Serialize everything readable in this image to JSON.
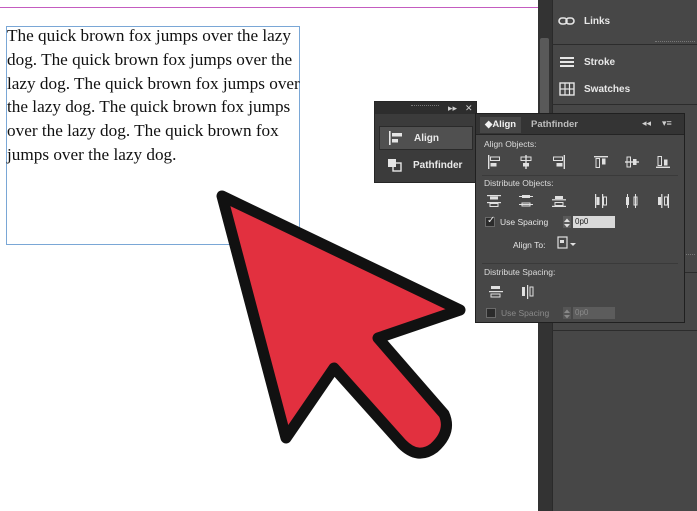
{
  "document": {
    "frame_text": "The quick brown fox jumps over the lazy dog. The quick brown fox jumps over the lazy dog. The quick brown fox jumps over the lazy dog. The quick brown fox jumps over the lazy dog. The quick brown fox jumps over the lazy dog."
  },
  "dock": {
    "items": [
      {
        "label": "Links",
        "icon": "links-icon"
      },
      {
        "label": "Stroke",
        "icon": "stroke-icon"
      },
      {
        "label": "Swatches",
        "icon": "swatches-icon"
      }
    ]
  },
  "mini_panel": {
    "collapse_glyph": "▸▸",
    "close_glyph": "✕",
    "items": [
      {
        "label": "Align",
        "icon": "align-panel-icon",
        "selected": true
      },
      {
        "label": "Pathfinder",
        "icon": "pathfinder-panel-icon",
        "selected": false
      }
    ]
  },
  "align_panel": {
    "tabs": [
      {
        "label": "Align",
        "active": true
      },
      {
        "label": "Pathfinder",
        "active": false
      }
    ],
    "collapse_glyph": "◂◂",
    "menu_glyph": "▾≡",
    "sections": {
      "align_objects": "Align Objects:",
      "distribute_objects": "Distribute Objects:",
      "distribute_spacing": "Distribute Spacing:"
    },
    "use_spacing_label": "Use Spacing",
    "use_spacing_value": "0p0",
    "align_to_label": "Align To:",
    "spacing_use_label": "Use Spacing",
    "spacing_value": "0p0",
    "accent_color": "#e0e0e0"
  },
  "cursor_arrow": {
    "fill_color": "#e2303f",
    "stroke_color": "#111111"
  }
}
